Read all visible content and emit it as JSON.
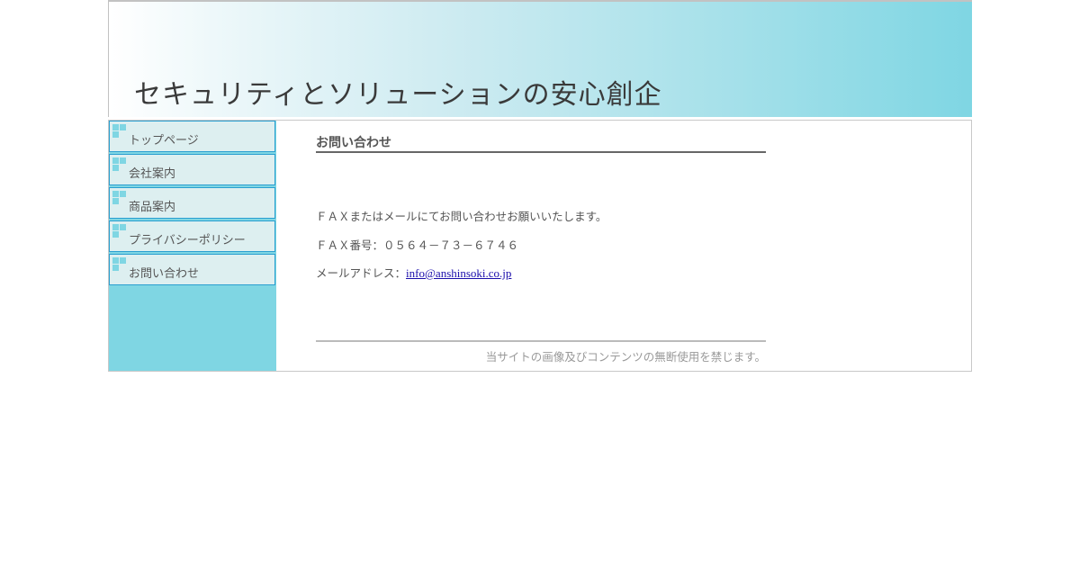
{
  "header": {
    "title": "セキュリティとソリューションの安心創企"
  },
  "sidebar": {
    "items": [
      {
        "label": "トップページ",
        "icon": "tile-bullet-icon"
      },
      {
        "label": "会社案内",
        "icon": "tile-bullet-icon"
      },
      {
        "label": "商品案内",
        "icon": "tile-bullet-icon"
      },
      {
        "label": "プライバシーポリシー",
        "icon": "tile-bullet-icon"
      },
      {
        "label": "お問い合わせ",
        "icon": "tile-bullet-icon"
      }
    ]
  },
  "main": {
    "title": "お問い合わせ",
    "intro": "ＦＡＸまたはメールにてお問い合わせお願いいたします。",
    "fax": "ＦＡＸ番号：０５６４－７３－６７４６",
    "email_label": "メールアドレス：",
    "email_link": "info@anshinsoki.co.jp"
  },
  "footer": {
    "note": "当サイトの画像及びコンテンツの無断使用を禁じます。"
  },
  "colors": {
    "accent": "#7fd6e3",
    "nav_border": "#2a9fd0",
    "nav_bg": "#ddeff0",
    "link": "#1a0dab"
  }
}
